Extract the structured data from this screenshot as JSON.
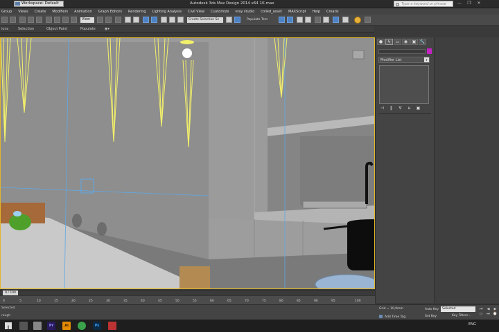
{
  "app": {
    "title": "Autodesk 3ds Max Design 2014 x64     1K.max",
    "workspace": "Workspace: Default"
  },
  "help_search": {
    "placeholder": "Type a keyword or phrase"
  },
  "menu": [
    "Group",
    "Views",
    "Create",
    "Modifiers",
    "Animation",
    "Graph Editors",
    "Rendering",
    "Lighting Analysis",
    "Civil View",
    "Customize",
    "vray studio",
    "colled_asset",
    "MAXScript",
    "Help",
    "Creatis"
  ],
  "toolbar": {
    "view_dropdown": "View",
    "named_selection": "Create Selection Se",
    "populate_text": "Populate Tem"
  },
  "ribbon": {
    "tabs": [
      "ions",
      "Selection",
      "Object Paint",
      "Populate"
    ]
  },
  "command_panel": {
    "tabs": [
      "●",
      "↳",
      "▭",
      "◉",
      "▣",
      "🔧"
    ],
    "modifier_list": "Modifier List",
    "stack_tools": [
      "⊣",
      "‖",
      "∀",
      "⊌",
      "▣"
    ]
  },
  "timeline": {
    "slider": "0 / 100",
    "ticks": [
      "0",
      "5",
      "10",
      "15",
      "20",
      "25",
      "30",
      "35",
      "40",
      "45",
      "50",
      "55",
      "60",
      "65",
      "70",
      "75",
      "80",
      "85",
      "90",
      "95",
      "100"
    ]
  },
  "status": {
    "selected": "Selected",
    "rough": "rough",
    "grid": "Grid = 10,0mm",
    "add_time_tag": "Add Time Tag",
    "auto_key": "Auto Key",
    "selected_dropdown": "Selected",
    "set_key": "Set Key",
    "key_filters": "Key Filters..."
  },
  "playback": [
    "⏮",
    "◀",
    "▶",
    "▷",
    "⏭",
    "⌚"
  ],
  "taskbar": {
    "apps": [
      "Pr",
      "Ai",
      "Ps"
    ],
    "tray": "ENG"
  },
  "colors": {
    "viewport_border": "#e1b62a",
    "spotlight": "#f3f06a",
    "guide": "#5fa8e6",
    "object_color": "#c424c4"
  },
  "icons": [
    "search-icon",
    "minimize-icon",
    "maximize-icon",
    "close-icon",
    "cog-icon",
    "light-icon"
  ]
}
